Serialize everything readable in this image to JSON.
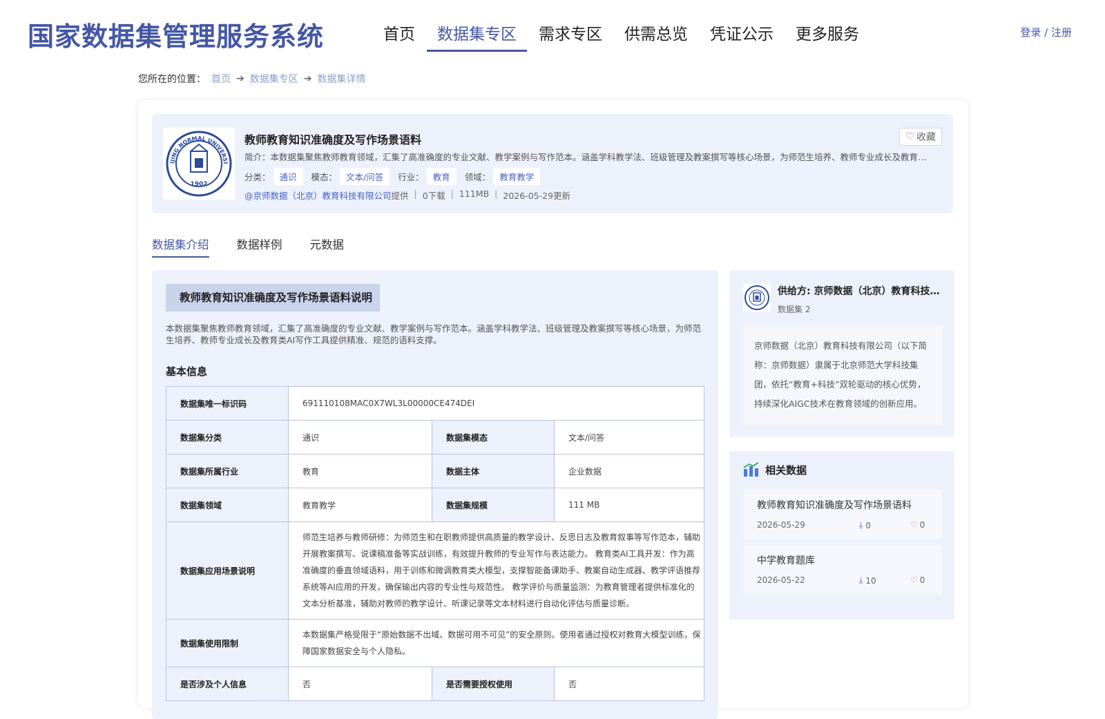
{
  "header": {
    "site_title": "国家数据集管理服务系统",
    "nav": [
      {
        "label": "首页"
      },
      {
        "label": "数据集专区"
      },
      {
        "label": "需求专区"
      },
      {
        "label": "供需总览"
      },
      {
        "label": "凭证公示"
      },
      {
        "label": "更多服务"
      }
    ],
    "active_nav": 1,
    "login_label": "登录 / 注册"
  },
  "breadcrumb": {
    "prefix": "您所在的位置：",
    "items": [
      "首页",
      "数据集专区",
      "数据集详情"
    ]
  },
  "dataset": {
    "title": "教师教育知识准确度及写作场景语料",
    "favorite_label": "收藏",
    "description": "简介：本数据集聚焦教师教育领域，汇集了高准确度的专业文献、教学案例与写作范本。涵盖学科教学法、班级管理及教案撰写等核心场景，为师范生培养、教师专业成长及教育类AI写作工具提供精准、规范的语料支撑。",
    "tag_labels": {
      "category": "分类：",
      "modality": "模态：",
      "industry": "行业：",
      "domain": "领域："
    },
    "tags": {
      "category": "通识",
      "modality": "文本/问答",
      "industry": "教育",
      "domain": "教育教学"
    },
    "provider": "@京师数据（北京）教育科技有限公司",
    "provider_suffix": "提供",
    "downloads": "0下载",
    "size": "111MB",
    "updated": "2026-05-29更新",
    "logo_text": {
      "arc": "BEIJING NORMAL UNIVERSITY",
      "year": "1902"
    }
  },
  "tabs": [
    "数据集介绍",
    "数据样例",
    "元数据"
  ],
  "active_tab": 0,
  "intro": {
    "banner": "教师教育知识准确度及写作场景语料说明",
    "text": "本数据集聚焦教师教育领域，汇集了高准确度的专业文献、教学案例与写作范本。涵盖学科教学法、班级管理及教案撰写等核心场景，为师范生培养、教师专业成长及教育类AI写作工具提供精准、规范的语料支撑。",
    "basic_title": "基本信息"
  },
  "table": {
    "id_label": "数据集唯一标识码",
    "id_value": "691110108MAC0X7WL3L00000CE474DEI",
    "category_label": "数据集分类",
    "category_value": "通识",
    "modality_label": "数据集模态",
    "modality_value": "文本/问答",
    "industry_label": "数据集所属行业",
    "industry_value": "教育",
    "subject_label": "数据主体",
    "subject_value": "企业数据",
    "domain_label": "数据集领域",
    "domain_value": "教育教学",
    "scale_label": "数据集规模",
    "scale_value": "111 MB",
    "scenario_label": "数据集应用场景说明",
    "scenario_value": "师范生培养与教师研修：为师范生和在职教师提供高质量的教学设计、反思日志及教育叙事等写作范本，辅助开展教案撰写、说课稿准备等实战训练，有效提升教师的专业写作与表达能力。 教育类AI工具开发：作为高准确度的垂直领域语料，用于训练和微调教育类大模型，支撑智能备课助手、教案自动生成器、教学评语推荐系统等AI应用的开发，确保输出内容的专业性与规范性。 教学评价与质量监测：为教育管理者提供标准化的文本分析基准，辅助对教师的教学设计、听课记录等文本材料进行自动化评估与质量诊断。",
    "limit_label": "数据集使用限制",
    "limit_value": "本数据集严格受限于“原始数据不出域、数据可用不可见”的安全原则。使用者通过授权对教育大模型训练，保障国家数据安全与个人隐私。",
    "personal_label": "是否涉及个人信息",
    "personal_value": "否",
    "auth_label": "是否需要授权使用",
    "auth_value": "否"
  },
  "supplier": {
    "name": "供给方: 京师数据（北京）教育科技有限公司",
    "count": "数据集 2",
    "description": "京师数据（北京）教育科技有限公司（以下简称：京师数据）隶属于北京师范大学科技集团，依托“教育+科技”双轮驱动的核心优势，持续深化AIGC技术在教育领域的创新应用。"
  },
  "related": {
    "title": "相关数据",
    "items": [
      {
        "name": "教师教育知识准确度及写作场景语料",
        "date": "2026-05-29",
        "downloads": "0",
        "likes": "0"
      },
      {
        "name": "中学教育题库",
        "date": "2026-05-22",
        "downloads": "10",
        "likes": "0"
      }
    ]
  },
  "colors": {
    "brand": "#4457a6",
    "panel": "#edf1fb",
    "tag_text": "#4a62c8",
    "like": "#e26a6a"
  },
  "icons": [
    "heart-icon",
    "arrow-right-icon",
    "download-icon",
    "bar-chart-icon",
    "university-seal-icon"
  ]
}
